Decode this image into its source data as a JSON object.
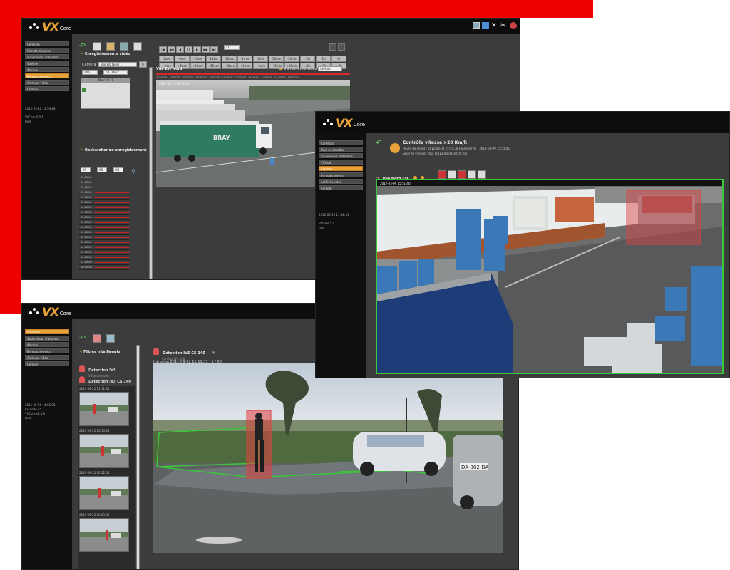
{
  "colors": {
    "accent": "#e8a23a",
    "red_block": "#ee0000",
    "detect_red": "#e04040",
    "zone_green": "#3ac83a"
  },
  "window_recordings": {
    "logo": {
      "vx": "VX",
      "core": "Core"
    },
    "sidebar": [
      {
        "label": "Caméras"
      },
      {
        "label": "Plan de situation"
      },
      {
        "label": "Superviseur d'alarmes"
      },
      {
        "label": "VXView"
      },
      {
        "label": "Alarmes"
      },
      {
        "label": "Enregistrements"
      },
      {
        "label": "Archives vidéo"
      },
      {
        "label": "Compte"
      }
    ],
    "sidebar_active_index": 5,
    "sidebar_note": "2012-03-12 11:39:28\n\nVXCore 5.0.1\nroot",
    "section_recordings": "Enregistrements vidéo",
    "camera_label": "Caméra",
    "camera_value": "Vue Est Nord",
    "year": "2012",
    "month": "03 - Mars",
    "calendar_title": "Mars 2012",
    "section_search": "Rechercher un enregistrement",
    "search_fields": [
      "09",
      "00",
      "00"
    ],
    "hours": [
      "00:00:00",
      "01:00:00",
      "02:00:00",
      "03:00:00",
      "04:00:00",
      "05:00:00",
      "06:00:00",
      "07:00:00",
      "08:00:00",
      "09:00:00",
      "10:00:00",
      "11:00:00",
      "12:00:00",
      "13:00:00",
      "14:00:00",
      "15:00:00",
      "16:00:00",
      "17:00:00",
      "18:00:00"
    ],
    "speed_row1": [
      "-2sec",
      "-5sec",
      "-10sec",
      "-15sec",
      "-30sec",
      "-1min",
      "-5min",
      "-15min",
      "-30min",
      "-1h",
      "-2h",
      "-4h"
    ],
    "speed_row2": [
      "+2sec",
      "+5sec",
      "+10sec",
      "+15sec",
      "+30sec",
      "+1min",
      "+5min",
      "+15min",
      "+30min",
      "+1h",
      "+2h",
      "+4h"
    ],
    "speed_select": "x1",
    "video_title": "Vue Est Nord",
    "video_option": "Tramsmettre vidéo",
    "video_select": "(défaut)",
    "timeline": "10:00:00 · 10:00:00 · 10:00:00 · 10:30:00 · 11:00:00 · 11:30:00 · 12:00:00 · 12:30:00 · 13:00:00 · 13:30:00 · 14:00:00",
    "timestamp_overlay": "2012-03-12 09:32:51"
  },
  "window_speed": {
    "logo": {
      "vx": "VX",
      "core": "Core"
    },
    "sidebar": [
      {
        "label": "Caméras"
      },
      {
        "label": "Plan de situation"
      },
      {
        "label": "Superviseur d'alarmes"
      },
      {
        "label": "VXView"
      },
      {
        "label": "Alarmes"
      },
      {
        "label": "Enregistrements"
      },
      {
        "label": "Archives vidéo"
      },
      {
        "label": "Compte"
      }
    ],
    "sidebar_active_index": 4,
    "sidebar_note": "2012-03-12 11:38:41\n\nVXCore 5.0.1\nroot",
    "alarm_title": "Contrôle vitesse >20 Km/h",
    "alarm_line1": "Heure de début : 2012-03-09 15:51:38   Heure de fin : 2012-03-09 15:51:45",
    "alarm_line2": "Seuil de vitesse : root (2012-03-09 18:09:25)",
    "camera_title": "Vue Nord Est",
    "overlay_timestamp": "2012-03-09 15:51:40"
  },
  "window_detection": {
    "logo": {
      "vx": "VX",
      "core": "Core"
    },
    "sidebar": [
      {
        "label": "Caméras"
      },
      {
        "label": "Superviseur d'alarmes"
      },
      {
        "label": "Alarmes"
      },
      {
        "label": "Enregistrements"
      },
      {
        "label": "Archives vidéo"
      },
      {
        "label": "Compte"
      }
    ],
    "sidebar_active_index": 0,
    "sidebar_note": "2011-09-26 14:06:06\nCE Code 55\nVXCore v5.0.0\nroot",
    "filters_title": "Filtres intelligents",
    "filters": [
      {
        "title": "Détection IVS",
        "sub": "IVS accessibles"
      },
      {
        "title": "Détection IVS CS 140",
        "sub": "Caméra IVS 140"
      }
    ],
    "thumb_captions": [
      "2011-09-22 11:11:31",
      "2011-09-22 10:55:34",
      "2011-09-22 10:52:55",
      "2011-09-22 10:05:54"
    ],
    "video_title": "Détection IVS CS 140",
    "video_sub": "Caméra IVS 140",
    "video_timestamp": "Intrusion 2011-09-22 11:11:31 · 1 / 50",
    "plate": "DA-882-DA"
  }
}
